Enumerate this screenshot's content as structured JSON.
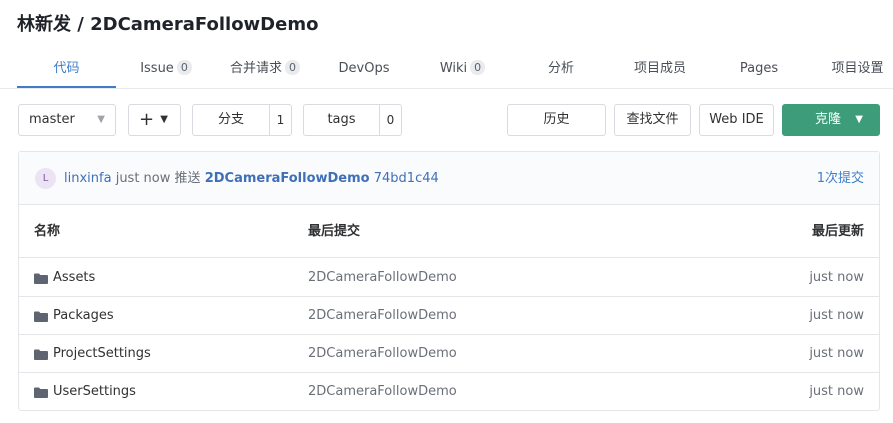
{
  "repo": {
    "title": "林新发 / 2DCameraFollowDemo"
  },
  "tabs": [
    {
      "label": "代码",
      "count": null,
      "active": true
    },
    {
      "label": "Issue",
      "count": "0"
    },
    {
      "label": "合并请求",
      "count": "0"
    },
    {
      "label": "DevOps",
      "count": null
    },
    {
      "label": "Wiki",
      "count": "0"
    },
    {
      "label": "分析",
      "count": null
    },
    {
      "label": "项目成员",
      "count": null
    },
    {
      "label": "Pages",
      "count": null
    },
    {
      "label": "项目设置",
      "count": null
    }
  ],
  "toolbar": {
    "branch_value": "master",
    "plus_label": "+",
    "branches_label": "分支",
    "branches_count": "1",
    "tags_label": "tags",
    "tags_count": "0",
    "history_label": "历史",
    "find_file_label": "查找文件",
    "web_ide_label": "Web IDE",
    "clone_label": "克隆"
  },
  "commit": {
    "avatar_letter": "L",
    "author": "linxinfa",
    "time": "just now",
    "action": "推送",
    "message": "2DCameraFollowDemo",
    "hash": "74bd1c44",
    "count_label": "1次提交"
  },
  "table": {
    "headers": {
      "name": "名称",
      "commit": "最后提交",
      "date": "最后更新"
    },
    "rows": [
      {
        "name": "Assets",
        "commit": "2DCameraFollowDemo",
        "date": "just now"
      },
      {
        "name": "Packages",
        "commit": "2DCameraFollowDemo",
        "date": "just now"
      },
      {
        "name": "ProjectSettings",
        "commit": "2DCameraFollowDemo",
        "date": "just now"
      },
      {
        "name": "UserSettings",
        "commit": "2DCameraFollowDemo",
        "date": "just now"
      }
    ]
  },
  "colors": {
    "accent": "#3f7ec7",
    "clone_button": "#3d9d7b",
    "link": "#3f6fb8"
  },
  "icons": {
    "folder": "folder-icon",
    "chevron": "chevron-down-icon"
  }
}
